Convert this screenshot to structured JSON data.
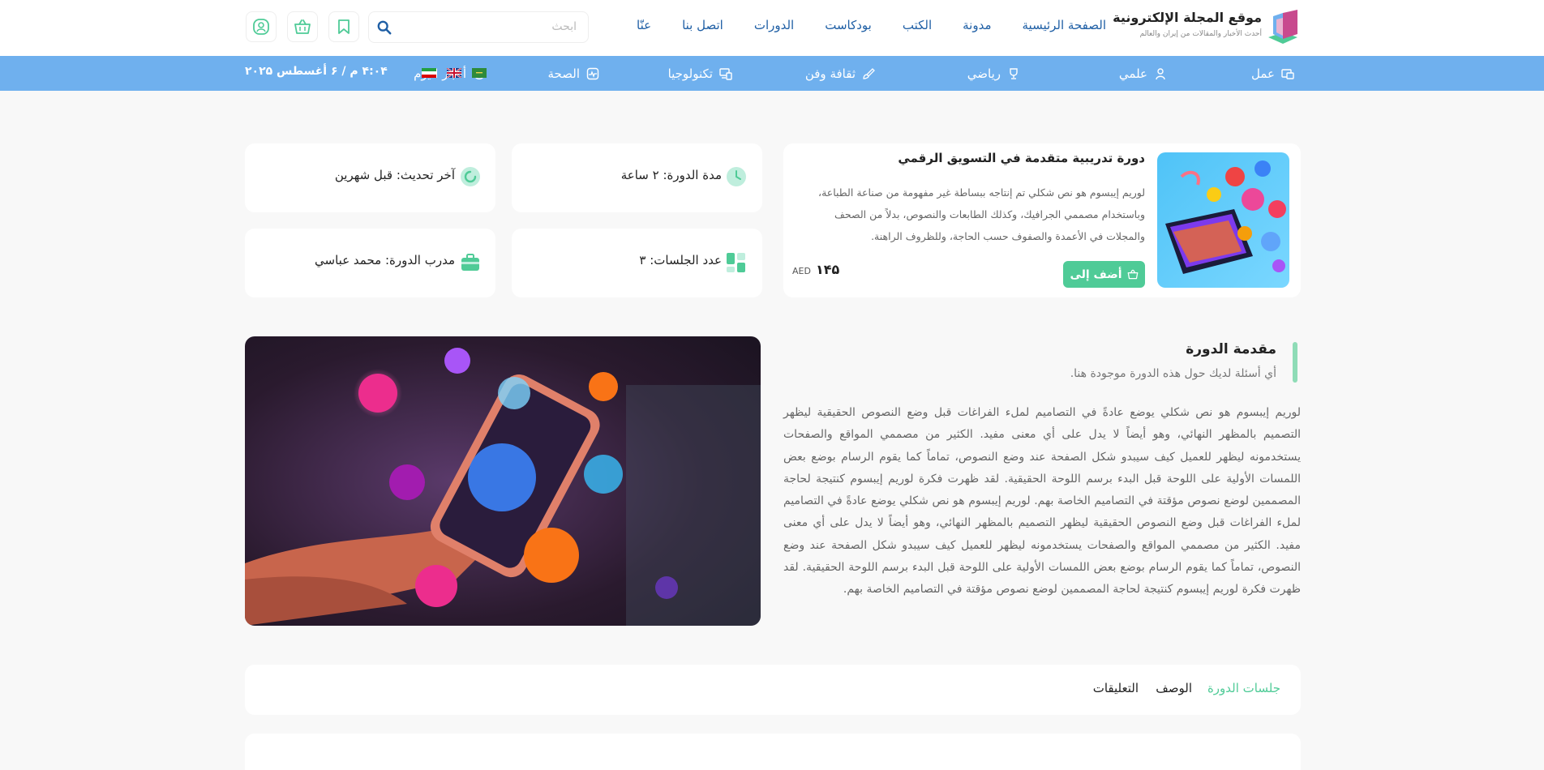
{
  "site": {
    "title": "موقع المجلة الإلكترونية",
    "subtitle": "أحدث الأخبار والمقالات من إيران والعالم"
  },
  "nav": {
    "items": [
      "الصفحة الرئيسية",
      "مدونة",
      "الكتب",
      "بودكاست",
      "الدورات",
      "اتصل بنا",
      "عنّا"
    ]
  },
  "search": {
    "placeholder": "ابحث"
  },
  "icons": {
    "search": "search-icon",
    "bookmark": "bookmark-icon",
    "cart": "basket-icon",
    "user": "user-icon",
    "play": "play-icon"
  },
  "categories": [
    {
      "label": "عمل",
      "icon": "business-icon"
    },
    {
      "label": "علمي",
      "icon": "person-icon"
    },
    {
      "label": "رياضي",
      "icon": "trophy-icon"
    },
    {
      "label": "ثقافة وفن",
      "icon": "brush-icon"
    },
    {
      "label": "تكنولوجيا",
      "icon": "devices-icon"
    },
    {
      "label": "الصحة",
      "icon": "health-icon"
    },
    {
      "label": "أخبار اليوم",
      "icon": "news-icon"
    }
  ],
  "flags": [
    "iran",
    "united-kingdom",
    "saudi"
  ],
  "datetime": "۴:۰۴ م / ۶ أغسطس ۲۰۲۵",
  "course": {
    "title": "دورة تدريبية متقدمة في التسويق الرقمي",
    "description": "لوريم إيبسوم هو نص شكلي تم إنتاجه ببساطة غير مفهومة من صناعة الطباعة، وباستخدام مصممي الجرافيك، وكذلك الطابعات والنصوص، بدلاً من الصحف والمجلات في الأعمدة والصفوف حسب الحاجة، وللظروف الراهنة.",
    "add_button": "أضف إلى",
    "price": "۱۴۵",
    "currency": "AED"
  },
  "info": {
    "duration": "مدة الدورة: ۲ ساعة",
    "last_update": "آخر تحديث: قبل شهرين",
    "sessions": "عدد الجلسات: ۳",
    "instructor": "مدرب الدورة: محمد عباسي"
  },
  "intro": {
    "title": "مقدمة الدورة",
    "subtitle": "أي أسئلة لديك حول هذه الدورة موجودة هنا.",
    "body": "لوريم إيبسوم هو نص شكلي يوضع عادةً في التصاميم لملء الفراغات قبل وضع النصوص الحقيقية ليظهر التصميم بالمظهر النهائي، وهو أيضاً لا يدل على أي معنى مفيد. الكثير من مصممي المواقع والصفحات يستخدمونه ليظهر للعميل كيف سيبدو شكل الصفحة عند وضع النصوص، تماماً كما يقوم الرسام بوضع بعض اللمسات الأولية على اللوحة قبل البدء برسم اللوحة الحقيقية. لقد ظهرت فكرة لوريم إيبسوم كنتيجة لحاجة المصممين لوضع نصوص مؤقتة في التصاميم الخاصة بهم. لوريم إيبسوم هو نص شكلي يوضع عادةً في التصاميم لملء الفراغات قبل وضع النصوص الحقيقية ليظهر التصميم بالمظهر النهائي، وهو أيضاً لا يدل على أي معنى مفيد. الكثير من مصممي المواقع والصفحات يستخدمونه ليظهر للعميل كيف سيبدو شكل الصفحة عند وضع النصوص، تماماً كما يقوم الرسام بوضع بعض اللمسات الأولية على اللوحة قبل البدء برسم اللوحة الحقيقية. لقد ظهرت فكرة لوريم إيبسوم كنتيجة لحاجة المصممين لوضع نصوص مؤقتة في التصاميم الخاصة بهم."
  },
  "tabs": [
    "جلسات الدورة",
    "الوصف",
    "التعليقات"
  ],
  "colors": {
    "accent": "#4fcb97",
    "category_bar": "#6fb0ee",
    "nav_link": "#1f5fa5"
  }
}
